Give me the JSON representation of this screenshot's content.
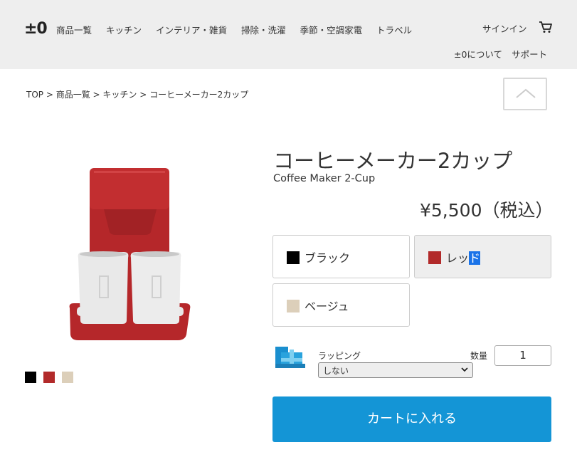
{
  "header": {
    "logo": "±0",
    "nav": [
      "商品一覧",
      "キッチン",
      "インテリア・雑貨",
      "掃除・洗濯",
      "季節・空調家電",
      "トラベル"
    ],
    "signin": "サインイン",
    "links": [
      "±0について",
      "サポート"
    ]
  },
  "breadcrumb": "TOP > 商品一覧 > キッチン > コーヒーメーカー2カップ",
  "product": {
    "title": "コーヒーメーカー2カップ",
    "subtitle": "Coffee Maker 2-Cup",
    "price": "¥5,500（税込）",
    "colors": [
      {
        "label_a": "ブラック",
        "label_b": "",
        "hex": "#000000"
      },
      {
        "label_a": "レッ",
        "label_b": "ド",
        "hex": "#b22a2a"
      },
      {
        "label_a": "ベージュ",
        "label_b": "",
        "hex": "#dccfba"
      }
    ],
    "thumb_colors": [
      "#000000",
      "#b22a2a",
      "#dccfba"
    ]
  },
  "wrapping": {
    "label": "ラッピング",
    "selected": "しない"
  },
  "quantity": {
    "label": "数量",
    "value": "1"
  },
  "cart_button": "カートに入れる"
}
